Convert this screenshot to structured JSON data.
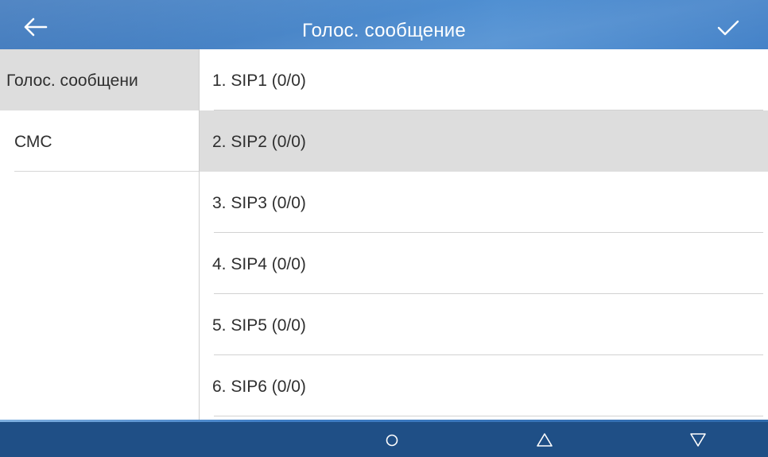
{
  "header": {
    "title": "Голос. сообщение",
    "back_icon": "arrow-left-icon",
    "confirm_icon": "checkmark-icon"
  },
  "sidebar": {
    "items": [
      {
        "label": "Голос. сообщени",
        "selected": true
      },
      {
        "label": "СМС",
        "selected": false
      }
    ]
  },
  "list": {
    "items": [
      {
        "label": "1.  SIP1 (0/0)",
        "selected": false
      },
      {
        "label": "2.  SIP2 (0/0)",
        "selected": true
      },
      {
        "label": "3.  SIP3 (0/0)",
        "selected": false
      },
      {
        "label": "4.  SIP4 (0/0)",
        "selected": false
      },
      {
        "label": "5.  SIP5 (0/0)",
        "selected": false
      },
      {
        "label": "6.  SIP6 (0/0)",
        "selected": false
      }
    ]
  },
  "bottom_bar": {
    "buttons": [
      {
        "icon": "circle-icon"
      },
      {
        "icon": "triangle-up-icon"
      },
      {
        "icon": "triangle-down-icon"
      }
    ]
  },
  "colors": {
    "header_bg": "#4a86c8",
    "bottom_bar_bg": "#1f4f86",
    "selected_bg": "#dddddd",
    "text": "#2f2f2f"
  }
}
